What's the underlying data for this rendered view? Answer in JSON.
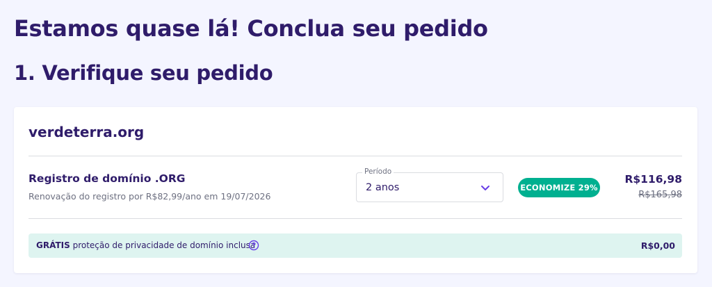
{
  "heading": "Estamos quase lá! Conclua seu pedido",
  "step_title": "1. Verifique seu pedido",
  "order": {
    "domain": "verdeterra.org",
    "product_title": "Registro de domínio .ORG",
    "renewal_text": "Renovação do registro por R$82,99/ano em 19/07/2026",
    "period_label": "Período",
    "period_value": "2 anos",
    "discount_badge": "ECONOMIZE 29%",
    "price": "R$116,98",
    "old_price": "R$165,98"
  },
  "privacy": {
    "free_label": "GRÁTIS",
    "text": "proteção de privacidade de domínio inclusa",
    "price": "R$0,00",
    "help_icon": "question-circle-icon"
  },
  "colors": {
    "background": "#f4f5ff",
    "primary_text": "#2f1c6a",
    "accent": "#673de6",
    "badge": "#00b090",
    "privacy_bg": "#def4f0"
  }
}
